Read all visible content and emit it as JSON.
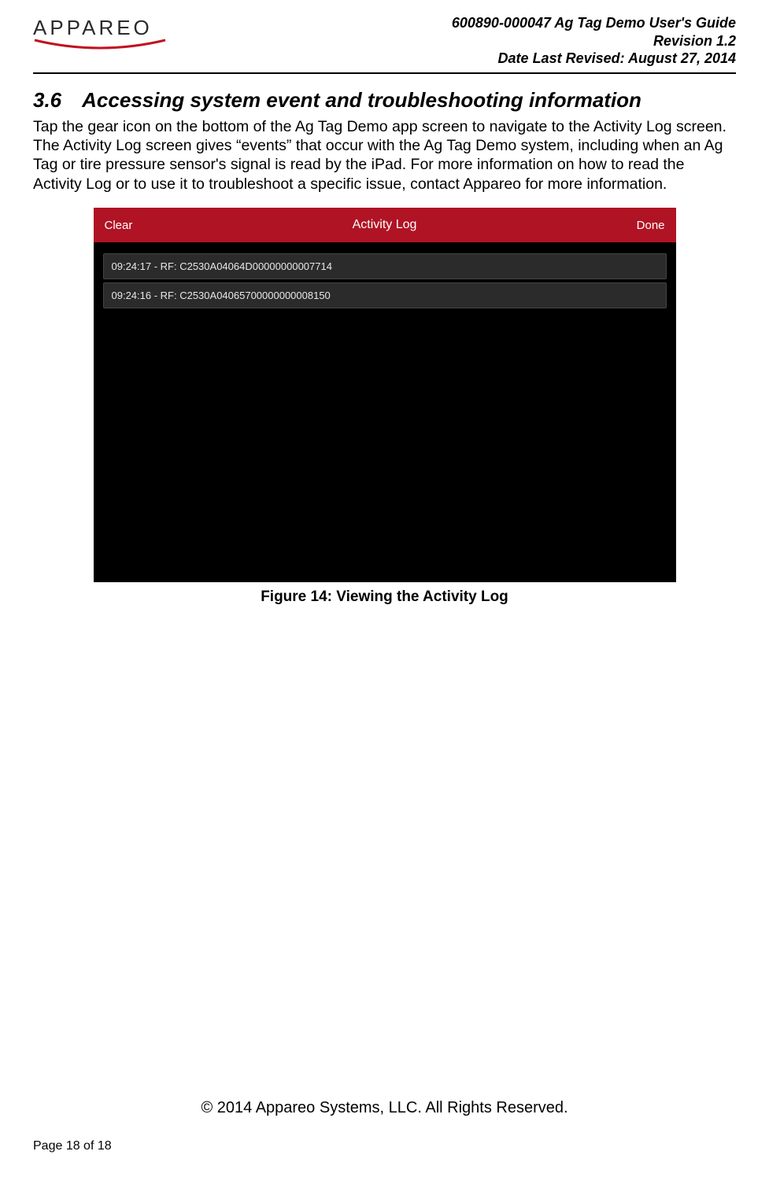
{
  "header": {
    "logo_text": "APPAREO",
    "doc_title": "600890-000047 Ag Tag Demo User's Guide",
    "revision": "Revision 1.2",
    "date_line": "Date Last Revised: August 27, 2014"
  },
  "section": {
    "number": "3.6",
    "title": "Accessing system event and troubleshooting information",
    "paragraph": "Tap the gear icon on the bottom of the Ag Tag Demo app screen to navigate to the Activity Log screen. The Activity Log screen gives “events” that occur with the Ag Tag Demo system, including when an Ag Tag or tire pressure sensor's signal is read by the iPad. For more information on how to read the Activity Log or to use it to troubleshoot a specific issue, contact Appareo for more information."
  },
  "figure": {
    "app_bar": {
      "left": "Clear",
      "title": "Activity Log",
      "right": "Done"
    },
    "log_rows": [
      "09:24:17 - RF: C2530A04064D00000000007714",
      "09:24:16 - RF: C2530A04065700000000008150"
    ],
    "caption": "Figure 14: Viewing the Activity Log"
  },
  "footer": {
    "copyright": "© 2014 Appareo Systems, LLC. All Rights Reserved.",
    "page": "Page 18 of 18"
  }
}
